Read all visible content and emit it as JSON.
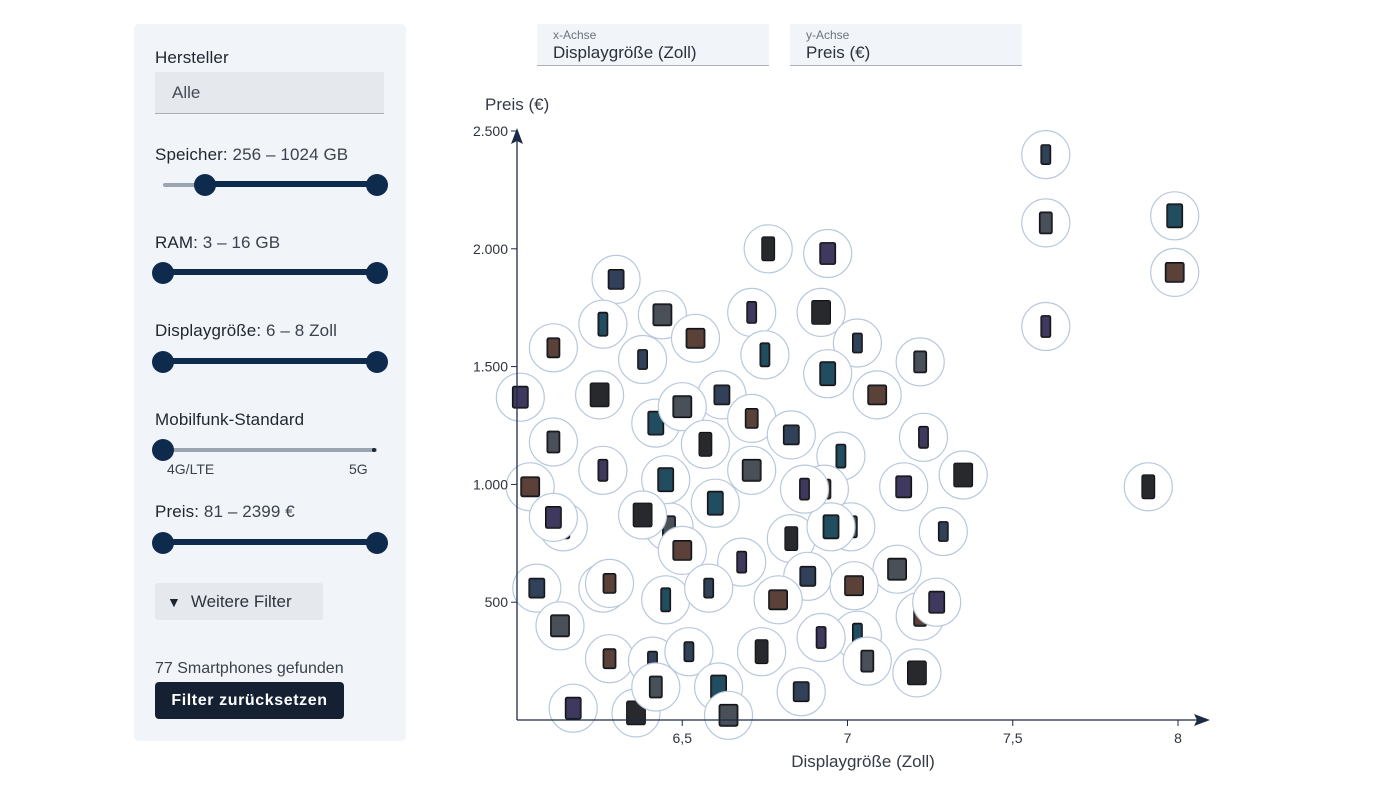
{
  "sidebar": {
    "manufacturer": {
      "label": "Hersteller",
      "value": "Alle"
    },
    "storage": {
      "label": "Speicher:",
      "value": "256 – 1024 GB",
      "low": 0.198,
      "high": 1.0
    },
    "ram": {
      "label": "RAM:",
      "value": "3 – 16 GB",
      "low": 0.0,
      "high": 1.0
    },
    "display": {
      "label": "Displaygröße:",
      "value": "6 – 8 Zoll",
      "low": 0.0,
      "high": 1.0
    },
    "network": {
      "label": "Mobilfunk-Standard",
      "value": 0.0,
      "marks": [
        "4G/LTE",
        "5G"
      ]
    },
    "price": {
      "label": "Preis:",
      "value": "81 – 2399 €",
      "low": 0.0,
      "high": 1.0
    },
    "more_filters": "Weitere Filter",
    "found": "77 Smartphones gefunden",
    "reset": "Filter zurücksetzen"
  },
  "axis_select": {
    "x": {
      "caption": "x-Achse",
      "value": "Displaygröße (Zoll)"
    },
    "y": {
      "caption": "y-Achse",
      "value": "Preis (€)"
    }
  },
  "chart_data": {
    "type": "scatter",
    "title": "",
    "xlabel": "Displaygröße (Zoll)",
    "ylabel": "Preis (€)",
    "xlim": [
      6.0,
      8.0
    ],
    "ylim": [
      0,
      2500
    ],
    "xticks": [
      {
        "v": 6.5,
        "label": "6,5"
      },
      {
        "v": 7,
        "label": "7"
      },
      {
        "v": 7.5,
        "label": "7,5"
      },
      {
        "v": 8,
        "label": "8"
      }
    ],
    "yticks": [
      {
        "v": 500,
        "label": "500"
      },
      {
        "v": 1000,
        "label": "1.000"
      },
      {
        "v": 1500,
        "label": "1.500"
      },
      {
        "v": 2000,
        "label": "2.000"
      },
      {
        "v": 2500,
        "label": "2.500"
      }
    ],
    "colors": {
      "axis": "#1c2b45",
      "bubble_border": "#b8c8dc"
    },
    "points": [
      {
        "x": 7.6,
        "y": 2400
      },
      {
        "x": 7.6,
        "y": 2110
      },
      {
        "x": 7.99,
        "y": 2140
      },
      {
        "x": 7.99,
        "y": 1900
      },
      {
        "x": 7.6,
        "y": 1670
      },
      {
        "x": 7.91,
        "y": 990
      },
      {
        "x": 6.3,
        "y": 1870
      },
      {
        "x": 6.44,
        "y": 1720
      },
      {
        "x": 6.26,
        "y": 1680
      },
      {
        "x": 6.11,
        "y": 1580
      },
      {
        "x": 6.01,
        "y": 1370
      },
      {
        "x": 6.25,
        "y": 1380
      },
      {
        "x": 6.38,
        "y": 1530
      },
      {
        "x": 6.11,
        "y": 1180
      },
      {
        "x": 6.42,
        "y": 1260
      },
      {
        "x": 6.04,
        "y": 990
      },
      {
        "x": 6.26,
        "y": 1060
      },
      {
        "x": 6.14,
        "y": 820
      },
      {
        "x": 6.06,
        "y": 560
      },
      {
        "x": 6.13,
        "y": 400
      },
      {
        "x": 6.26,
        "y": 560
      },
      {
        "x": 6.28,
        "y": 260
      },
      {
        "x": 6.17,
        "y": 50
      },
      {
        "x": 6.36,
        "y": 30
      },
      {
        "x": 6.41,
        "y": 250
      },
      {
        "x": 6.46,
        "y": 820
      },
      {
        "x": 6.45,
        "y": 1020
      },
      {
        "x": 6.54,
        "y": 1620
      },
      {
        "x": 6.71,
        "y": 1730
      },
      {
        "x": 6.76,
        "y": 2000
      },
      {
        "x": 6.62,
        "y": 1380
      },
      {
        "x": 6.5,
        "y": 1330
      },
      {
        "x": 6.75,
        "y": 1550
      },
      {
        "x": 6.71,
        "y": 1280
      },
      {
        "x": 6.94,
        "y": 1980
      },
      {
        "x": 6.92,
        "y": 1730
      },
      {
        "x": 7.03,
        "y": 1600
      },
      {
        "x": 7.22,
        "y": 1520
      },
      {
        "x": 6.94,
        "y": 1470
      },
      {
        "x": 7.09,
        "y": 1380
      },
      {
        "x": 7.23,
        "y": 1200
      },
      {
        "x": 6.57,
        "y": 1170
      },
      {
        "x": 6.83,
        "y": 1210
      },
      {
        "x": 6.71,
        "y": 1060
      },
      {
        "x": 6.98,
        "y": 1120
      },
      {
        "x": 6.93,
        "y": 980
      },
      {
        "x": 7.17,
        "y": 990
      },
      {
        "x": 7.35,
        "y": 1040
      },
      {
        "x": 7.29,
        "y": 800
      },
      {
        "x": 7.01,
        "y": 820
      },
      {
        "x": 6.6,
        "y": 920
      },
      {
        "x": 6.5,
        "y": 720
      },
      {
        "x": 6.68,
        "y": 670
      },
      {
        "x": 6.83,
        "y": 770
      },
      {
        "x": 6.88,
        "y": 610
      },
      {
        "x": 7.15,
        "y": 640
      },
      {
        "x": 7.03,
        "y": 360
      },
      {
        "x": 7.22,
        "y": 440
      },
      {
        "x": 7.27,
        "y": 500
      },
      {
        "x": 7.21,
        "y": 200
      },
      {
        "x": 6.52,
        "y": 290
      },
      {
        "x": 6.42,
        "y": 140
      },
      {
        "x": 6.61,
        "y": 140
      },
      {
        "x": 6.79,
        "y": 510
      },
      {
        "x": 6.92,
        "y": 350
      },
      {
        "x": 6.74,
        "y": 290
      },
      {
        "x": 6.86,
        "y": 120
      },
      {
        "x": 6.64,
        "y": 20
      },
      {
        "x": 6.45,
        "y": 510
      },
      {
        "x": 6.28,
        "y": 580
      },
      {
        "x": 6.11,
        "y": 860
      },
      {
        "x": 6.38,
        "y": 870
      },
      {
        "x": 6.58,
        "y": 560
      },
      {
        "x": 7.06,
        "y": 250
      },
      {
        "x": 6.95,
        "y": 820
      },
      {
        "x": 7.02,
        "y": 570
      },
      {
        "x": 6.87,
        "y": 980
      }
    ]
  }
}
